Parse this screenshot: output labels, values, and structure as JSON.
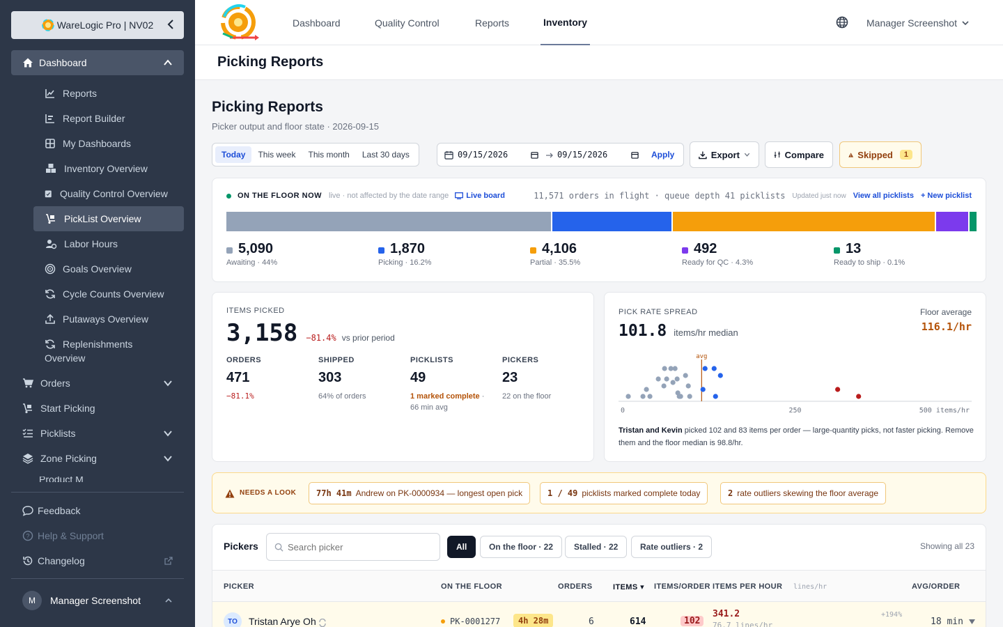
{
  "brand": {
    "name": "WareLogic Pro | NV02"
  },
  "sidebar": {
    "dashboard_label": "Dashboard",
    "sub_items": [
      {
        "label": "Reports",
        "icon": "chart-line-icon"
      },
      {
        "label": "Report Builder",
        "icon": "bar-chart-icon"
      },
      {
        "label": "My Dashboards",
        "icon": "grid-icon"
      },
      {
        "label": "Inventory Overview",
        "icon": "boxes-icon"
      },
      {
        "label": "Quality Control Overview",
        "icon": "clipboard-check-icon"
      },
      {
        "label": "PickList Overview",
        "icon": "dolly-icon"
      },
      {
        "label": "Labor Hours",
        "icon": "user-clock-icon"
      },
      {
        "label": "Goals Overview",
        "icon": "target-icon"
      },
      {
        "label": "Cycle Counts Overview",
        "icon": "refresh-icon"
      },
      {
        "label": "Putaways Overview",
        "icon": "upload-icon"
      },
      {
        "label": "Replenishments",
        "label2": "Overview",
        "icon": "refresh-icon"
      }
    ],
    "groups": [
      {
        "label": "Orders",
        "icon": "cart-icon"
      },
      {
        "label": "Start Picking",
        "icon": "dolly-icon"
      },
      {
        "label": "Picklists",
        "icon": "list-check-icon"
      },
      {
        "label": "Zone Picking",
        "icon": "layers-icon"
      }
    ],
    "cut_item": "Product M",
    "footer": {
      "feedback": "Feedback",
      "help": "Help & Support",
      "changelog": "Changelog"
    },
    "user": {
      "initial": "M",
      "name": "Manager Screenshot"
    }
  },
  "topbar": {
    "tabs": [
      "Dashboard",
      "Quality Control",
      "Reports",
      "Inventory"
    ],
    "active_tab": "Inventory",
    "user_menu": "Manager Screenshot"
  },
  "page": {
    "header_title": "Picking Reports",
    "title": "Picking Reports",
    "subtitle": "Picker output and floor state · 2026-09-15"
  },
  "toolbar": {
    "ranges": [
      "Today",
      "This week",
      "This month",
      "Last 30 days"
    ],
    "active_range": "Today",
    "date_from": "09/15/2026",
    "date_to": "09/15/2026",
    "apply": "Apply",
    "export": "Export",
    "compare": "Compare",
    "skipped_label": "Skipped",
    "skipped_count": "1"
  },
  "floor": {
    "label": "ON THE FLOOR NOW",
    "live_note": "live · not affected by the date range",
    "live_board": "Live board",
    "in_flight": "11,571 orders in flight · queue depth 41 picklists",
    "updated": "Updated just now",
    "view_all": "View all picklists",
    "new_picklist": "+ New picklist",
    "segments": [
      {
        "value": "5,090",
        "desc": "Awaiting · 44%",
        "share": 44.0,
        "color": "#94a3b8"
      },
      {
        "value": "1,870",
        "desc": "Picking · 16.2%",
        "share": 16.2,
        "color": "#2563eb"
      },
      {
        "value": "4,106",
        "desc": "Partial · 35.5%",
        "share": 35.5,
        "color": "#f59e0b"
      },
      {
        "value": "492",
        "desc": "Ready for QC · 4.3%",
        "share": 4.3,
        "color": "#7c3aed"
      },
      {
        "value": "13",
        "desc": "Ready to ship · 0.1%",
        "share": 0.1,
        "color": "#059669"
      }
    ]
  },
  "items_picked": {
    "label": "ITEMS PICKED",
    "value": "3,158",
    "delta": "−81.4%",
    "delta_note": "vs prior period",
    "stats": [
      {
        "label": "ORDERS",
        "value": "471",
        "note": "−81.1%"
      },
      {
        "label": "SHIPPED",
        "value": "303",
        "note": "64% of orders"
      },
      {
        "label": "PICKLISTS",
        "value": "49",
        "note_strong": "1 marked complete",
        "note": "·",
        "note2": "66 min avg"
      },
      {
        "label": "PICKERS",
        "value": "23",
        "note": "22 on the floor"
      }
    ]
  },
  "pick_rate": {
    "label": "PICK RATE SPREAD",
    "median": "101.8",
    "median_unit": "items/hr median",
    "floor_avg_label": "Floor average",
    "floor_avg": "116.1/hr",
    "avg_marker": "avg",
    "axis_ticks": [
      "0",
      "250",
      "500 items/hr"
    ],
    "note_names": "Tristan and Kevin",
    "note_text": "picked 102 and 83 items per order — large-quantity picks, not faster picking. Remove them and the floor median is 98.8/hr."
  },
  "chart_data": {
    "type": "scatter",
    "title": "PICK RATE SPREAD",
    "xlabel": "items/hr",
    "xlim": [
      0,
      500
    ],
    "x_ticks": [
      "0",
      "250",
      "500 items/hr"
    ],
    "avg_line": 116.1,
    "series": [
      {
        "color": "#94a3b8",
        "points": [
          [
            11,
            0.1
          ],
          [
            32,
            0.1
          ],
          [
            37,
            0.3
          ],
          [
            42,
            0.1
          ],
          [
            54,
            0.6
          ],
          [
            62,
            0.4
          ],
          [
            63,
            0.9
          ],
          [
            66,
            0.6
          ],
          [
            72,
            0.9
          ],
          [
            75,
            0.5
          ],
          [
            78,
            0.9
          ],
          [
            81,
            0.6
          ],
          [
            82,
            0.2
          ],
          [
            84,
            0.1
          ],
          [
            86,
            0.1
          ],
          [
            93,
            0.7
          ],
          [
            97,
            0.4
          ],
          [
            99,
            0.1
          ]
        ]
      },
      {
        "color": "#2563eb",
        "points": [
          [
            118,
            0.3
          ],
          [
            121,
            0.9
          ],
          [
            134,
            0.9
          ],
          [
            136,
            0.1
          ],
          [
            143,
            0.7
          ]
        ]
      },
      {
        "color": "#b91c1c",
        "points": [
          [
            311,
            0.3
          ],
          [
            341,
            0.1
          ]
        ]
      }
    ]
  },
  "needs_look": {
    "label": "NEEDS A LOOK",
    "chips": [
      {
        "strong": "77h 41m",
        "text": "Andrew on PK-0000934 — longest open pick"
      },
      {
        "strong": "1 / 49",
        "text": "picklists marked complete today"
      },
      {
        "strong": "2",
        "text": "rate outliers skewing the floor average"
      }
    ]
  },
  "pickers": {
    "title": "Pickers",
    "search_placeholder": "Search picker",
    "filters": [
      "All",
      "On the floor · 22",
      "Stalled · 22",
      "Rate outliers · 2"
    ],
    "showing": "Showing all 23",
    "columns": {
      "picker": "PICKER",
      "floor": "ON THE FLOOR",
      "orders": "ORDERS",
      "items": "ITEMS ▾",
      "items_order": "ITEMS/ORDER",
      "iph": "ITEMS PER HOUR",
      "lines_hr": "lines/hr",
      "avg_order": "AVG/ORDER"
    },
    "rows": [
      {
        "initials": "TO",
        "name": "Tristan Arye Oh",
        "picklist": "PK-0001277",
        "duration": "4h 28m",
        "orders": "6",
        "items": "614",
        "items_order": "102",
        "iph": "341.2",
        "lines": "76.7 lines/hr",
        "delta": "+194%",
        "avg_order": "18 min"
      }
    ]
  }
}
